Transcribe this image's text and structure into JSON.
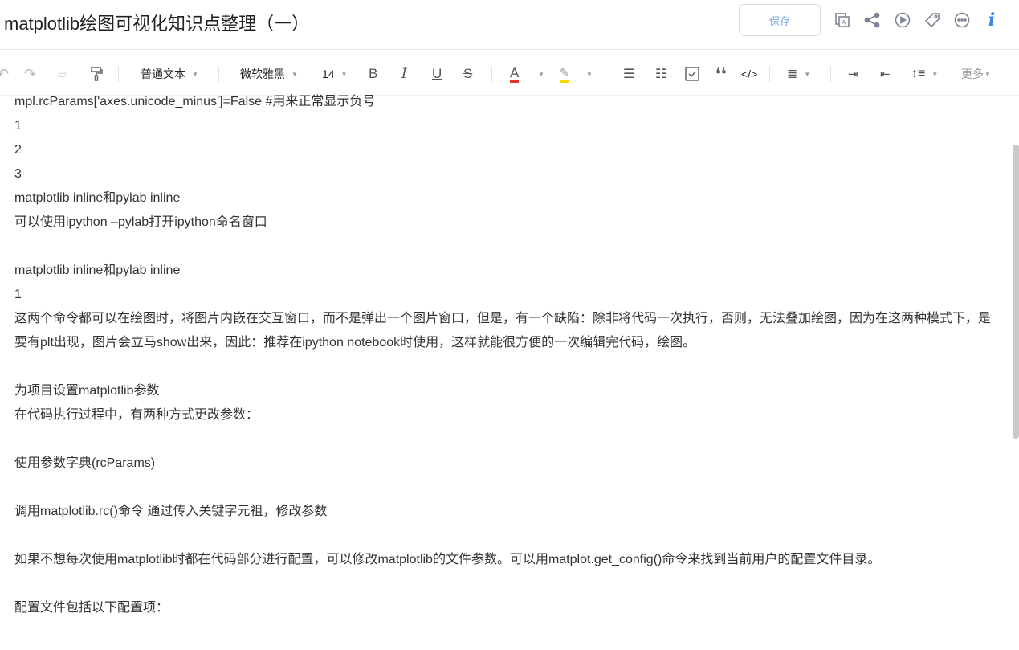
{
  "header": {
    "title": "matplotlib绘图可视化知识点整理（一）",
    "save_label": "保存"
  },
  "toolbar": {
    "paragraph_style": "普通文本",
    "font_family": "微软雅黑",
    "font_size": "14",
    "more_label": "更多",
    "font_color": "#e0382c",
    "highlight_color": "#f5d800"
  },
  "content": {
    "lines": [
      "mpl.rcParams['axes.unicode_minus']=False #用来正常显示负号",
      "1",
      "2",
      "3",
      "matplotlib inline和pylab inline",
      "可以使用ipython –pylab打开ipython命名窗口",
      "",
      "matplotlib inline和pylab inline",
      "1",
      "这两个命令都可以在绘图时，将图片内嵌在交互窗口，而不是弹出一个图片窗口，但是，有一个缺陷：除非将代码一次执行，否则，无法叠加绘图，因为在这两种模式下，是要有plt出现，图片会立马show出来，因此：推荐在ipython notebook时使用，这样就能很方便的一次编辑完代码，绘图。",
      "",
      "为项目设置matplotlib参数",
      "在代码执行过程中，有两种方式更改参数：",
      "",
      "使用参数字典(rcParams)",
      "",
      "调用matplotlib.rc()命令 通过传入关键字元祖，修改参数",
      "",
      "如果不想每次使用matplotlib时都在代码部分进行配置，可以修改matplotlib的文件参数。可以用matplot.get_config()命令来找到当前用户的配置文件目录。",
      "",
      "配置文件包括以下配置项："
    ]
  }
}
